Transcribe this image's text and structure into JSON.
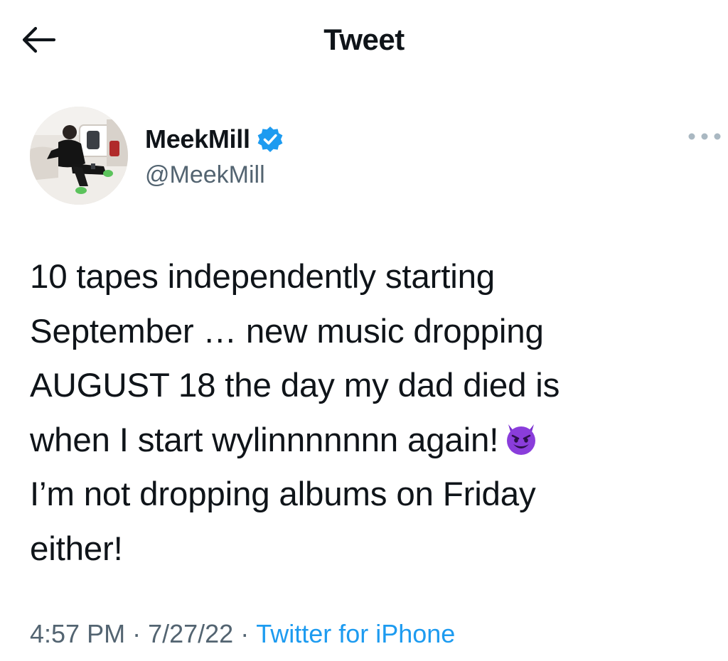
{
  "header": {
    "title": "Tweet",
    "back_icon": "arrow-left-icon"
  },
  "author": {
    "display_name": "MeekMill",
    "handle": "@MeekMill",
    "verified": true,
    "verified_color": "#1d9bf0",
    "avatar_icon": "profile-photo"
  },
  "more_icon": "more-options-icon",
  "tweet": {
    "lines": [
      "10 tapes independently starting",
      "September … new music dropping",
      "AUGUST 18  the day my dad died is",
      "when I start wylinnnnnnn again!",
      "I’m not dropping albums on Friday",
      "either!"
    ],
    "emoji": "smiling-devil-emoji",
    "emoji_color": "#8a3ddb"
  },
  "meta": {
    "time": "4:57 PM",
    "separator": "·",
    "date": "7/27/22",
    "source": "Twitter for iPhone"
  },
  "colors": {
    "text": "#0f1419",
    "secondary": "#536471",
    "link": "#1d9bf0",
    "background": "#ffffff"
  }
}
